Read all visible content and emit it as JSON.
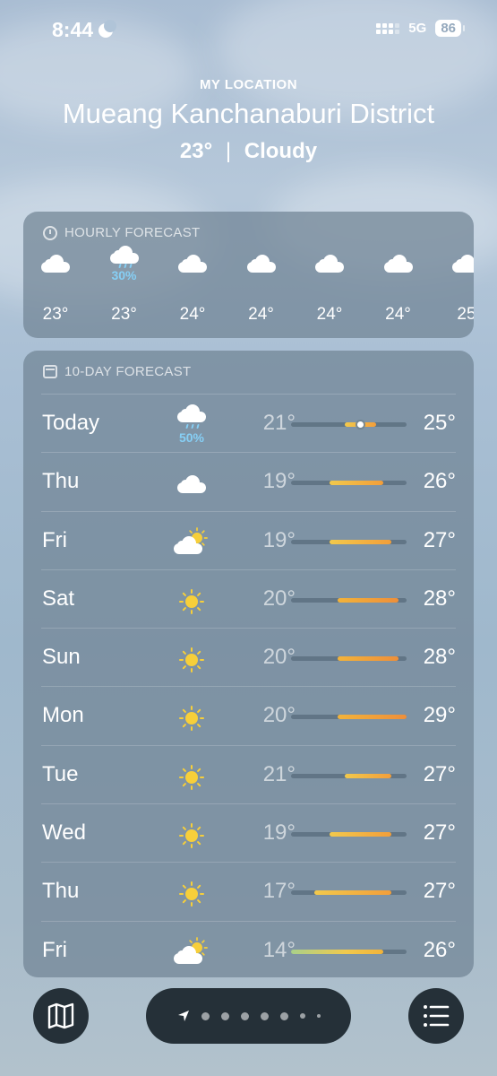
{
  "status_bar": {
    "time": "8:44",
    "network": "5G",
    "battery": "86"
  },
  "header": {
    "location_label": "MY LOCATION",
    "location_name": "Mueang Kanchanaburi District",
    "temperature": "23°",
    "separator": "|",
    "condition": "Cloudy"
  },
  "hourly": {
    "title": "HOURLY FORECAST",
    "items": [
      {
        "icon": "cloud-icon",
        "temp": "23°",
        "precip": ""
      },
      {
        "icon": "cloud-rain-icon",
        "temp": "23°",
        "precip": "30%"
      },
      {
        "icon": "cloud-icon",
        "temp": "24°",
        "precip": ""
      },
      {
        "icon": "cloud-icon",
        "temp": "24°",
        "precip": ""
      },
      {
        "icon": "cloud-icon",
        "temp": "24°",
        "precip": ""
      },
      {
        "icon": "cloud-icon",
        "temp": "24°",
        "precip": ""
      },
      {
        "icon": "cloud-icon",
        "temp": "25",
        "precip": ""
      }
    ]
  },
  "daily": {
    "title": "10-DAY FORECAST",
    "range": [
      14,
      29
    ],
    "days": [
      {
        "day": "Today",
        "icon": "cloud-rain-icon",
        "precip": "50%",
        "low": "21°",
        "high": "25°",
        "lo": 21,
        "hi": 25,
        "current": 23
      },
      {
        "day": "Thu",
        "icon": "cloud-icon",
        "precip": "",
        "low": "19°",
        "high": "26°",
        "lo": 19,
        "hi": 26
      },
      {
        "day": "Fri",
        "icon": "partly-sunny-icon",
        "precip": "",
        "low": "19°",
        "high": "27°",
        "lo": 19,
        "hi": 27
      },
      {
        "day": "Sat",
        "icon": "sun-icon",
        "precip": "",
        "low": "20°",
        "high": "28°",
        "lo": 20,
        "hi": 28
      },
      {
        "day": "Sun",
        "icon": "sun-icon",
        "precip": "",
        "low": "20°",
        "high": "28°",
        "lo": 20,
        "hi": 28
      },
      {
        "day": "Mon",
        "icon": "sun-icon",
        "precip": "",
        "low": "20°",
        "high": "29°",
        "lo": 20,
        "hi": 29
      },
      {
        "day": "Tue",
        "icon": "sun-icon",
        "precip": "",
        "low": "21°",
        "high": "27°",
        "lo": 21,
        "hi": 27
      },
      {
        "day": "Wed",
        "icon": "sun-icon",
        "precip": "",
        "low": "19°",
        "high": "27°",
        "lo": 19,
        "hi": 27
      },
      {
        "day": "Thu",
        "icon": "sun-icon",
        "precip": "",
        "low": "17°",
        "high": "27°",
        "lo": 17,
        "hi": 27
      },
      {
        "day": "Fri",
        "icon": "partly-sunny-icon",
        "precip": "",
        "low": "14°",
        "high": "26°",
        "lo": 14,
        "hi": 26
      }
    ]
  },
  "bottom_bar": {
    "map_icon": "map-icon",
    "location_icon": "location-arrow-icon",
    "list_icon": "list-icon",
    "page_count": 7
  },
  "colors": {
    "precip": "#86cff5",
    "sun": "#f7cf3a",
    "bar_warm": "#f29e3a",
    "bar_mild": "#f2c94c"
  }
}
